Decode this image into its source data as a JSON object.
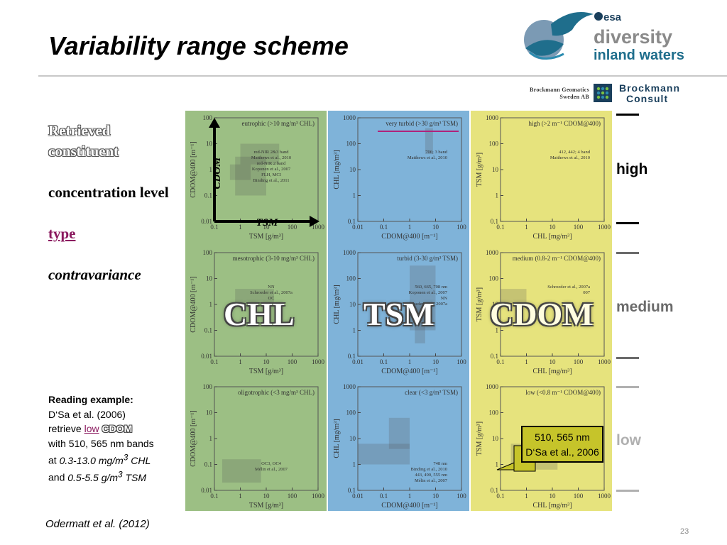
{
  "slide": {
    "title": "Variability range scheme",
    "footer": "Odermatt et al. (2012)",
    "page_number": "23"
  },
  "logos": {
    "esa_prefix": "esa",
    "diversity": "diversity",
    "inland": "inland waters",
    "bg_line1": "Brockmann Geomatics",
    "bg_line2": "Sweden AB",
    "bc_line1": "Brockmann",
    "bc_line2": "Consult"
  },
  "left": {
    "retrieved": "Retrieved constituent",
    "concentration": "concentration level",
    "type": "type",
    "contravariance": "contravariance"
  },
  "reading": {
    "heading": "Reading example:",
    "line2": "D‘Sa et al. (2006)",
    "retrieve": "retrieve",
    "low": "low",
    "cdom": "CDOM",
    "line4": "with 510, 565 nm bands",
    "at": "at",
    "chl_range": "0.3-13.0 mg/m",
    "chl_unit": "CHL",
    "and": "and",
    "tsm_range": "0.5-5.5 g/m",
    "tsm_unit": "TSM",
    "sup": "3"
  },
  "columns": {
    "chl": "CHL",
    "tsm": "TSM",
    "cdom": "CDOM"
  },
  "levels": {
    "high": "high",
    "medium": "medium",
    "low": "low"
  },
  "colors": {
    "high": "#000000",
    "medium": "#6b6b6b",
    "low": "#b0b0b0",
    "chl_bg": "#9cbf84",
    "tsm_bg": "#7fb3d9",
    "cdom_bg": "#e6e37d",
    "accent": "#8b1a5f"
  },
  "callout": {
    "line1": "510, 565 nm",
    "line2": "D‘Sa et al., 2006"
  },
  "arrows": {
    "y": "CDOM",
    "x": "TSM"
  },
  "chart_data": [
    {
      "type": "scatter",
      "panel": "chl-high",
      "title": "eutrophic (>10 mg/m³ CHL)",
      "xlabel": "TSM [g/m³]",
      "ylabel": "CDOM@400 [m⁻¹]",
      "x_ticks": [
        "0.1",
        "1",
        "10",
        "100",
        "1000"
      ],
      "y_ticks": [
        "0.01",
        "0.1",
        "1",
        "10",
        "100"
      ],
      "annotations": [
        "red-NIR 2&3 band",
        "Matthews et al., 2010",
        "red-NIR 2 band",
        "Koponen et al., 2007",
        "FLH, MCI",
        "Binding et al., 2011"
      ]
    },
    {
      "type": "scatter",
      "panel": "tsm-high",
      "title": "very turbid (>30 g/m³ TSM)",
      "xlabel": "CDOM@400 [m⁻¹]",
      "ylabel": "CHL [mg/m³]",
      "x_ticks": [
        "0.01",
        "0.1",
        "1",
        "10",
        "100"
      ],
      "y_ticks": [
        "0.1",
        "1",
        "10",
        "100",
        "1000"
      ],
      "annotations": [
        "706; 3 band",
        "Matthews et al., 2010"
      ]
    },
    {
      "type": "scatter",
      "panel": "cdom-high",
      "title": "high (>2 m⁻¹ CDOM@400)",
      "xlabel": "CHL [mg/m³]",
      "ylabel": "TSM [g/m³]",
      "x_ticks": [
        "0.1",
        "1",
        "10",
        "100",
        "1000"
      ],
      "y_ticks": [
        "0.1",
        "1",
        "10",
        "100",
        "1000"
      ],
      "annotations": [
        "412, 442; 4 band",
        "Matthews et al., 2010"
      ]
    },
    {
      "type": "scatter",
      "panel": "chl-medium",
      "title": "mesotrophic (3-10 mg/m³ CHL)",
      "xlabel": "TSM [g/m³]",
      "ylabel": "CDOM@400 [m⁻¹]",
      "x_ticks": [
        "0.1",
        "1",
        "10",
        "100",
        "1000"
      ],
      "y_ticks": [
        "0.01",
        "0.1",
        "1",
        "10",
        "100"
      ],
      "annotations": [
        "NN",
        "Schroeder et al., 2007a",
        "OC"
      ]
    },
    {
      "type": "scatter",
      "panel": "tsm-medium",
      "title": "turbid (3-30 g/m³ TSM)",
      "xlabel": "CDOM@400 [m⁻¹]",
      "ylabel": "CHL [mg/m³]",
      "x_ticks": [
        "0.01",
        "0.1",
        "1",
        "10",
        "100"
      ],
      "y_ticks": [
        "0.1",
        "1",
        "10",
        "100",
        "1000"
      ],
      "annotations": [
        "560, 665, 708 nm",
        "Koponen et al., 2007",
        "NN",
        "Schroeder et al., 2007a"
      ]
    },
    {
      "type": "scatter",
      "panel": "cdom-medium",
      "title": "medium (0.8-2 m⁻¹ CDOM@400)",
      "xlabel": "CHL [mg/m³]",
      "ylabel": "TSM [g/m³]",
      "x_ticks": [
        "0.1",
        "1",
        "10",
        "100",
        "1000"
      ],
      "y_ticks": [
        "0.1",
        "1",
        "10",
        "100",
        "1000"
      ],
      "annotations": [
        "Schroeder et al., 2007a",
        "007"
      ]
    },
    {
      "type": "scatter",
      "panel": "chl-low",
      "title": "oligotrophic (<3 mg/m³ CHL)",
      "xlabel": "TSM [g/m³]",
      "ylabel": "CDOM@400 [m⁻¹]",
      "x_ticks": [
        "0.1",
        "1",
        "10",
        "100",
        "1000"
      ],
      "y_ticks": [
        "0.01",
        "0.1",
        "1",
        "10",
        "100"
      ],
      "annotations": [
        "OC3, OC4",
        "Mélin et al., 2007"
      ]
    },
    {
      "type": "scatter",
      "panel": "tsm-low",
      "title": "clear (<3 g/m³ TSM)",
      "xlabel": "CDOM@400 [m⁻¹]",
      "ylabel": "CHL [mg/m³]",
      "x_ticks": [
        "0.01",
        "0.1",
        "1",
        "10",
        "100"
      ],
      "y_ticks": [
        "0.1",
        "1",
        "10",
        "100",
        "1000"
      ],
      "annotations": [
        "748 nm",
        "Binding et al., 2010",
        "443, 490, 555 nm",
        "Mélin et al., 2007"
      ]
    },
    {
      "type": "scatter",
      "panel": "cdom-low",
      "title": "low (<0.8 m⁻¹ CDOM@400)",
      "xlabel": "CHL [mg/m³]",
      "ylabel": "TSM [g/m³]",
      "x_ticks": [
        "0.1",
        "1",
        "10",
        "100",
        "1000"
      ],
      "y_ticks": [
        "0.1",
        "1",
        "10",
        "100",
        "1000"
      ],
      "annotations": []
    }
  ]
}
